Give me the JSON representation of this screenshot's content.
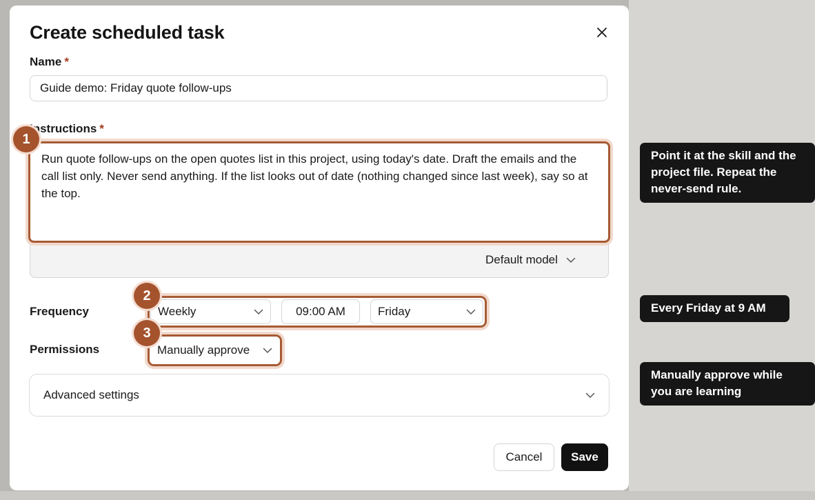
{
  "modal": {
    "title": "Create scheduled task"
  },
  "name_field": {
    "label": "Name",
    "required_mark": "*",
    "value": "Guide demo: Friday quote follow-ups"
  },
  "instructions_field": {
    "label": "Instructions",
    "required_mark": "*",
    "value": "Run quote follow-ups on the open quotes list in this project, using today's date. Draft the emails and the call list only. Never send anything. If the list looks out of date (nothing changed since last week), say so at the top.",
    "model_select": "Default model"
  },
  "frequency": {
    "label": "Frequency",
    "interval": "Weekly",
    "time": "09:00 AM",
    "day": "Friday"
  },
  "permissions": {
    "label": "Permissions",
    "value": "Manually approve"
  },
  "advanced": {
    "label": "Advanced settings"
  },
  "actions": {
    "cancel": "Cancel",
    "save": "Save"
  },
  "callouts": [
    {
      "number": "1",
      "text": "Point it at the skill and the project file. Repeat the never-send rule."
    },
    {
      "number": "2",
      "text": "Every Friday at 9 AM"
    },
    {
      "number": "3",
      "text": "Manually approve while you are learning"
    }
  ],
  "colors": {
    "accent": "#a65a34",
    "badge": "#a4532d",
    "tooltip_bg": "#161616",
    "save_bg": "#111111",
    "required": "#a33a1e"
  },
  "icons": {
    "close": "close-icon",
    "dropdown": "chevron-down-icon"
  }
}
